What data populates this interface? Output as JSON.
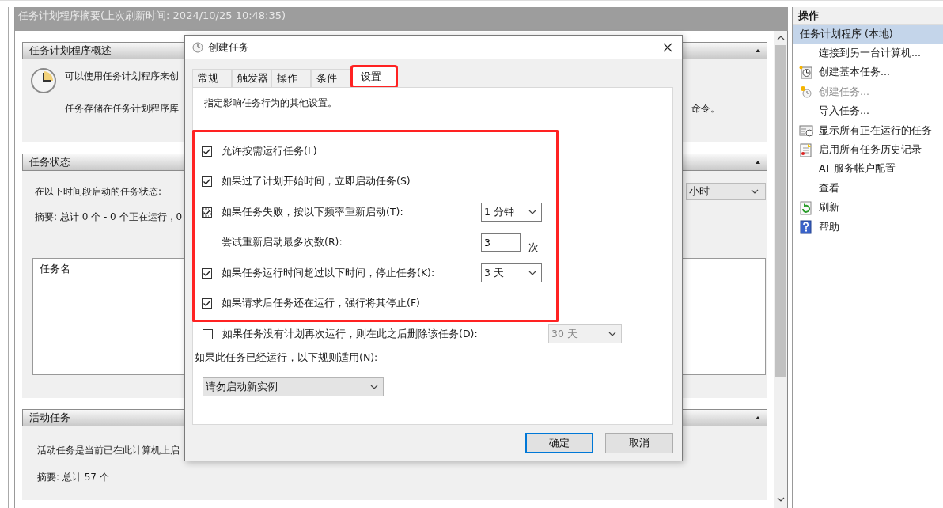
{
  "main": {
    "header_title": "任务计划程序摘要(上次刷新时间: 2024/10/25 10:48:35)",
    "overview": {
      "title": "任务计划程序概述",
      "line_1": "可以使用任务计划程序来创",
      "line_2": "任务存储在任务计划程序库",
      "line_2_tail": "命令。"
    },
    "status": {
      "title": "任务状态",
      "label": "在以下时间段启动的任务状态:",
      "period": "小时",
      "summary": "摘要: 总计 0 个 - 0 个正在运行，0",
      "list_column": "任务名"
    },
    "active": {
      "title": "活动任务",
      "description": "活动任务是当前已在此计算机上启",
      "summary": "摘要: 总计 57 个"
    }
  },
  "actions": {
    "title": "操作",
    "items": [
      {
        "label": "任务计划程序 (本地)",
        "kind": "node",
        "selected": true,
        "disabled": false
      },
      {
        "label": "连接到另一台计算机...",
        "kind": "plain",
        "selected": false,
        "disabled": false
      },
      {
        "label": "创建基本任务...",
        "kind": "basic-task",
        "selected": false,
        "disabled": false
      },
      {
        "label": "创建任务...",
        "kind": "task",
        "selected": false,
        "disabled": true
      },
      {
        "label": "导入任务...",
        "kind": "plain",
        "selected": false,
        "disabled": false
      },
      {
        "label": "显示所有正在运行的任务",
        "kind": "running",
        "selected": false,
        "disabled": false
      },
      {
        "label": "启用所有任务历史记录",
        "kind": "history",
        "selected": false,
        "disabled": false
      },
      {
        "label": "AT 服务帐户配置",
        "kind": "plain",
        "selected": false,
        "disabled": false
      },
      {
        "label": "查看",
        "kind": "plain",
        "selected": false,
        "disabled": false
      },
      {
        "label": "刷新",
        "kind": "refresh",
        "selected": false,
        "disabled": false
      },
      {
        "label": "帮助",
        "kind": "help",
        "selected": false,
        "disabled": false
      }
    ]
  },
  "dialog": {
    "title": "创建任务",
    "tabs": [
      {
        "label": "常规",
        "selected": false,
        "highlighted": false
      },
      {
        "label": "触发器",
        "selected": false,
        "highlighted": false
      },
      {
        "label": "操作",
        "selected": false,
        "highlighted": false
      },
      {
        "label": "条件",
        "selected": false,
        "highlighted": false
      },
      {
        "label": "设置",
        "selected": true,
        "highlighted": true
      }
    ],
    "description": "指定影响任务行为的其他设置。",
    "rows": [
      {
        "kind": "checkbox",
        "label": "允许按需运行任务(L)",
        "checked": true,
        "focused": false,
        "highlighted": true
      },
      {
        "kind": "checkbox",
        "label": "如果过了计划开始时间，立即启动任务(S)",
        "checked": true,
        "focused": false,
        "highlighted": true
      },
      {
        "kind": "checkbox",
        "label": "如果任务失败，按以下频率重新启动(T):",
        "checked": true,
        "focused": true,
        "highlighted": true,
        "control": {
          "kind": "dropdown",
          "value": "1 分钟",
          "disabled": false
        }
      },
      {
        "kind": "number",
        "label": "尝试重新启动最多次数(R):",
        "highlighted": true,
        "control": {
          "kind": "number",
          "value": "3",
          "unit": "次",
          "disabled": false
        }
      },
      {
        "kind": "checkbox",
        "label": "如果任务运行时间超过以下时间，停止任务(K):",
        "checked": true,
        "focused": false,
        "highlighted": true,
        "control": {
          "kind": "dropdown",
          "value": "3 天",
          "disabled": false
        }
      },
      {
        "kind": "checkbox",
        "label": "如果请求后任务还在运行，强行将其停止(F)",
        "checked": true,
        "focused": false,
        "highlighted": true
      },
      {
        "kind": "checkbox",
        "label": "如果任务没有计划再次运行，则在此之后删除该任务(D):",
        "checked": false,
        "focused": false,
        "highlighted": false,
        "control": {
          "kind": "dropdown",
          "value": "30 天",
          "disabled": true
        }
      },
      {
        "kind": "label",
        "label": "如果此任务已经运行，以下规则适用(N):",
        "highlighted": false
      },
      {
        "kind": "select",
        "value": "请勿启动新实例",
        "highlighted": false
      }
    ],
    "buttons": [
      {
        "label": "确定",
        "default": true
      },
      {
        "label": "取消",
        "default": false
      }
    ]
  }
}
